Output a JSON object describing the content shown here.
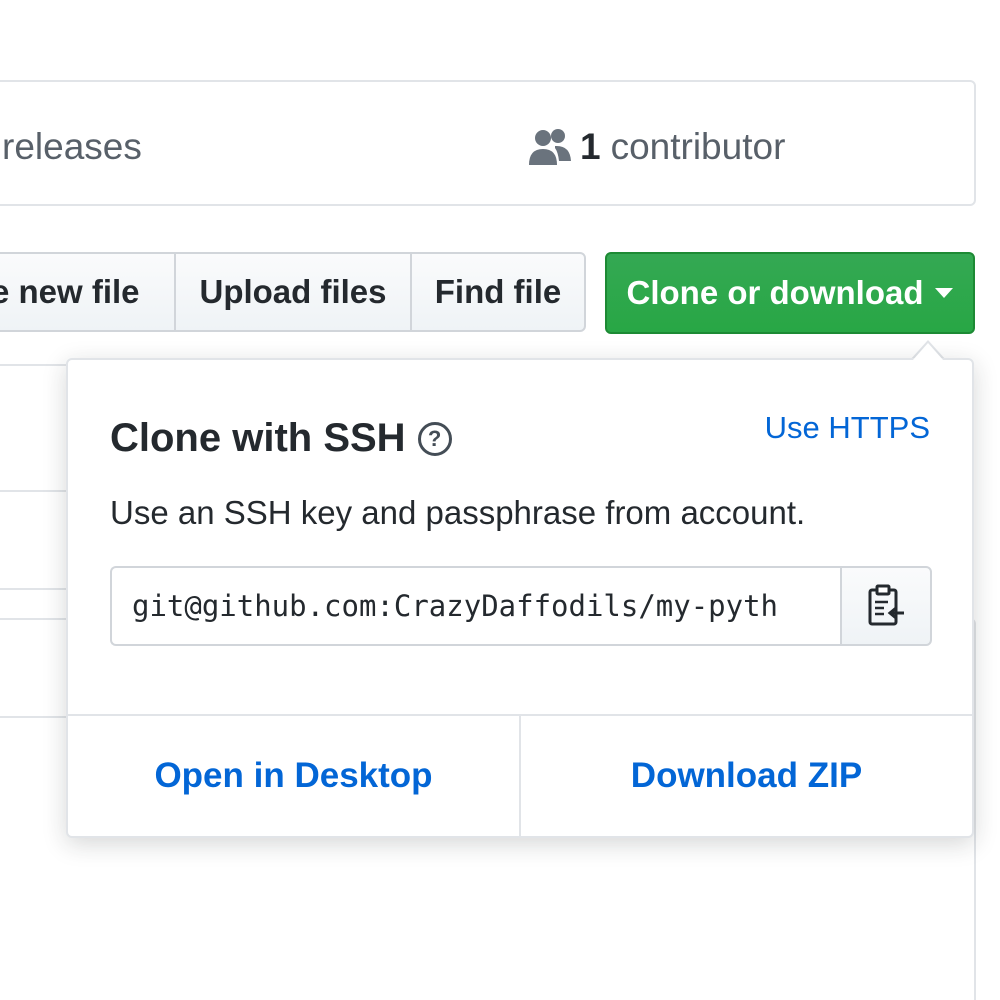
{
  "summary": {
    "releases_label": "releases",
    "contributors_count": "1",
    "contributors_label": "contributor",
    "contributors_icon": "people-icon"
  },
  "toolbar": {
    "create_label": "Create new file",
    "create_visible_label": "te new file",
    "upload_label": "Upload files",
    "find_label": "Find file",
    "clone_label": "Clone or download",
    "clone_icon": "caret-down-icon",
    "clone_color": "#28a745"
  },
  "clone_popover": {
    "title": "Clone with SSH",
    "help_glyph": "?",
    "switch_label": "Use HTTPS",
    "description": "Use an SSH key and passphrase from account.",
    "url_value": "git@github.com:CrazyDaffodils/my-pyth",
    "copy_icon": "clipboard-icon",
    "open_desktop_label": "Open in Desktop",
    "download_zip_label": "Download ZIP",
    "link_color": "#0366d6"
  }
}
